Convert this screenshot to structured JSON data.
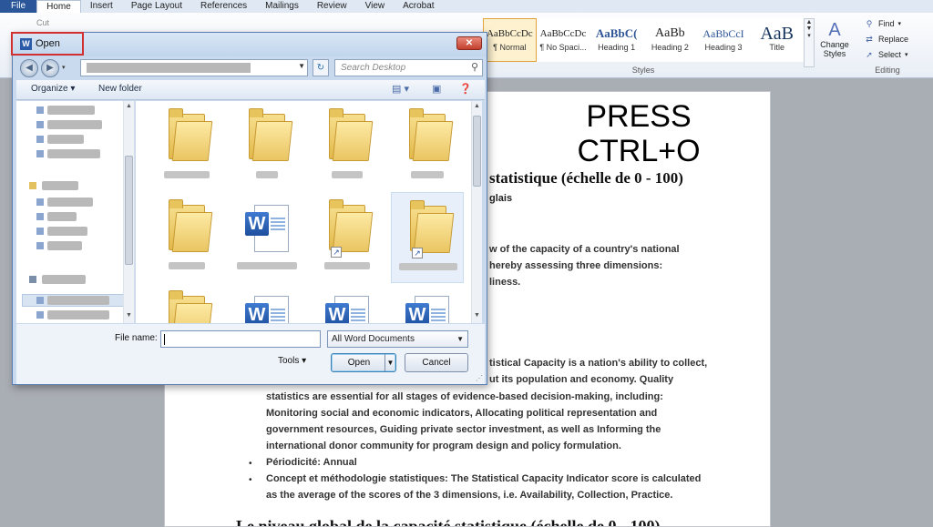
{
  "ribbon": {
    "tabs": [
      "File",
      "Home",
      "Insert",
      "Page Layout",
      "References",
      "Mailings",
      "Review",
      "View",
      "Acrobat"
    ],
    "active_tab": "Home",
    "cut_label": "Cut",
    "styles": [
      {
        "preview": "AaBbCcDc",
        "name": "¶ Normal"
      },
      {
        "preview": "AaBbCcDc",
        "name": "¶ No Spaci..."
      },
      {
        "preview": "AaBbC(",
        "name": "Heading 1"
      },
      {
        "preview": "AaBb",
        "name": "Heading 2"
      },
      {
        "preview": "AaBbCcI",
        "name": "Heading 3"
      },
      {
        "preview": "AaB",
        "name": "Title"
      }
    ],
    "styles_group_label": "Styles",
    "change_styles_label": "Change Styles",
    "editing": {
      "find": "Find",
      "replace": "Replace",
      "select": "Select"
    },
    "editing_group_label": "Editing"
  },
  "overlay": {
    "line1": "PRESS",
    "line2": "CTRL+O"
  },
  "document": {
    "heading": "statistique (échelle de 0 - 100)",
    "sub": "glais",
    "para1": [
      "w of the capacity of a country's national",
      "hereby assessing three dimensions:",
      "liness."
    ],
    "para2": [
      "tistical Capacity is a nation's ability to collect,",
      "ut its population and economy. Quality",
      "statistics are essential for all stages of evidence-based decision-making, including:",
      "Monitoring social and economic indicators, Allocating political representation and",
      "government resources, Guiding private sector investment, as well as Informing the",
      "international donor community for program design and policy formulation."
    ],
    "bullet1": "Périodicité: Annual",
    "bullet2_lines": [
      "Concept et méthodologie statistiques: The Statistical Capacity Indicator score is calculated",
      "as the average of the scores of the 3 dimensions, i.e. Availability, Collection, Practice."
    ],
    "bottom_heading": "Le niveau global de la capacité statistique (échelle de 0 - 100)"
  },
  "dialog": {
    "title": "Open",
    "search_placeholder": "Search Desktop",
    "organize": "Organize",
    "new_folder": "New folder",
    "file_name_label": "File name:",
    "file_name_value": "",
    "file_type": "All Word Documents",
    "tools": "Tools",
    "open": "Open",
    "cancel": "Cancel"
  }
}
